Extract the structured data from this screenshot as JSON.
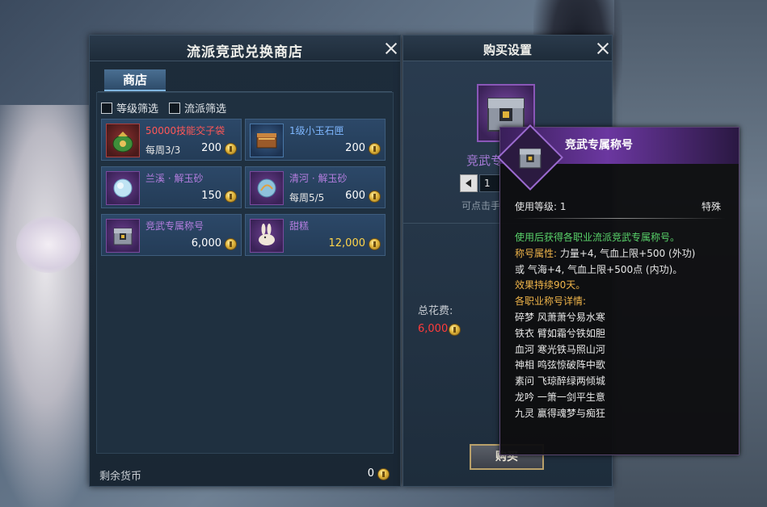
{
  "shop": {
    "title": "流派竞武兑换商店",
    "tab_label": "商店",
    "filters": [
      {
        "label": "等级筛选",
        "checked": false
      },
      {
        "label": "流派筛选",
        "checked": false
      }
    ],
    "items": [
      {
        "name": "50000技能交子袋",
        "limit": "每周3/3",
        "price": "200",
        "name_color": "red",
        "icon": "money-bag-icon"
      },
      {
        "name": "1级小玉石匣",
        "limit": "",
        "price": "200",
        "name_color": "blue",
        "icon": "jade-box-icon"
      },
      {
        "name": "兰溪 · 解玉砂",
        "limit": "",
        "price": "150",
        "name_color": "purple",
        "icon": "jade-sand-icon"
      },
      {
        "name": "清河 · 解玉砂",
        "limit": "每周5/5",
        "price": "600",
        "name_color": "purple",
        "icon": "jade-sand-icon"
      },
      {
        "name": "竞武专属称号",
        "limit": "",
        "price": "6,000",
        "name_color": "purple",
        "icon": "chest-icon"
      },
      {
        "name": "甜糕",
        "limit": "",
        "price": "12,000",
        "name_color": "purple",
        "icon": "rabbit-icon"
      }
    ],
    "remaining_label": "剩余货币",
    "remaining_value": "0"
  },
  "buy": {
    "title": "购买设置",
    "item_name": "竞武专",
    "quantity": "1",
    "hint": "可点击手",
    "total_label": "总花费:",
    "total_value": "6,000",
    "buy_label": "购买"
  },
  "tooltip": {
    "title": "竞武专属称号",
    "level_label": "使用等级: 1",
    "type_label": "特殊",
    "lines": [
      {
        "text": "使用后获得各职业流派竞武专属称号。",
        "color": "green"
      },
      {
        "text": "称号属性: 力量+4, 气血上限+500 (外功)",
        "color": "mixed"
      },
      {
        "text": "或 气海+4, 气血上限+500点 (内功)。",
        "color": "white"
      },
      {
        "text": "效果持续90天。",
        "color": "orange"
      },
      {
        "text": "各职业称号详情:",
        "color": "orange"
      },
      {
        "text": "碎梦  风萧萧兮易水寒",
        "color": "white"
      },
      {
        "text": "铁衣  臂如霜兮铁如胆",
        "color": "white"
      },
      {
        "text": "血河  寒光铁马照山河",
        "color": "white"
      },
      {
        "text": "神相  鸣弦惊破阵中歌",
        "color": "white"
      },
      {
        "text": "素问  飞琼醉绿两倾城",
        "color": "white"
      },
      {
        "text": "龙吟  一箫一剑平生意",
        "color": "white"
      },
      {
        "text": "九灵  赢得魂梦与痴狂",
        "color": "white"
      }
    ],
    "attr_prefix": "称号属性:",
    "attr_rest": " 力量+4, 气血上限+500 (外功)"
  },
  "colors": {
    "accent_blue": "#7fb5e0",
    "purple_name": "#b57ee0",
    "red_name": "#ff5757",
    "gold_price": "#ffd54a",
    "cost_red": "#ff3b3b"
  }
}
